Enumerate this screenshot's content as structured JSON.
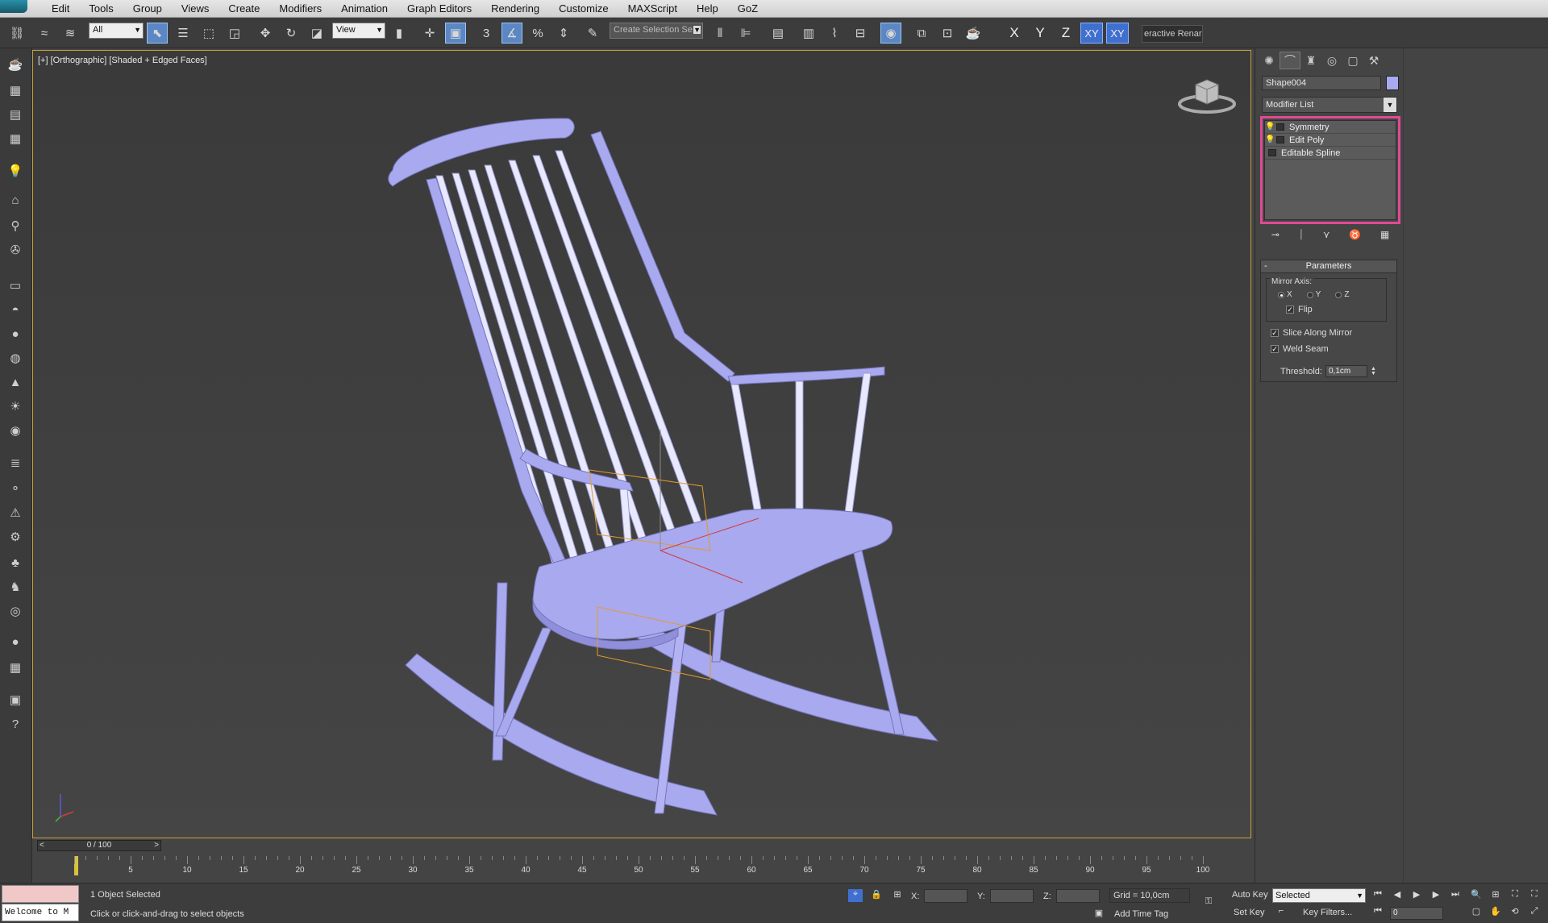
{
  "menubar": {
    "items": [
      "Edit",
      "Tools",
      "Group",
      "Views",
      "Create",
      "Modifiers",
      "Animation",
      "Graph Editors",
      "Rendering",
      "Customize",
      "MAXScript",
      "Help",
      "GoZ"
    ]
  },
  "toolbar": {
    "selection_filter": "All",
    "reference_coord": "View",
    "named_selection_placeholder": "Create Selection Se",
    "snap_label": "3",
    "percent_snap_label": "%",
    "axis_x": "X",
    "axis_y": "Y",
    "axis_z": "Z",
    "axis_xy": "XY",
    "axis_xy2": "XY",
    "render_label": "eractive Renar"
  },
  "viewport": {
    "label": "[+] [Orthographic] [Shaded + Edged Faces]",
    "mesh_color": "#a9a9f0",
    "selection_color": "#e39b2a"
  },
  "command_panel": {
    "object_name": "Shape004",
    "object_color": "#a9a9f0",
    "modifier_list": "Modifier List",
    "stack": [
      "Symmetry",
      "Edit Poly",
      "Editable Spline"
    ],
    "stack_highlight_color": "#e04a95",
    "parameters": {
      "title": "Parameters",
      "collapse": "-",
      "mirror_axis_label": "Mirror Axis:",
      "axis_options": [
        "X",
        "Y",
        "Z"
      ],
      "selected_axis": "X",
      "flip_label": "Flip",
      "flip_checked": true,
      "slice_label": "Slice Along Mirror",
      "slice_checked": true,
      "weld_label": "Weld Seam",
      "weld_checked": true,
      "threshold_label": "Threshold:",
      "threshold_value": "0,1cm"
    }
  },
  "timeline": {
    "slider_text": "0 / 100",
    "prev": "<",
    "next": ">",
    "ticks": [
      "5",
      "10",
      "15",
      "20",
      "25",
      "30",
      "35",
      "40",
      "45",
      "50",
      "55",
      "60",
      "65",
      "70",
      "75",
      "80",
      "85",
      "90",
      "95",
      "100"
    ]
  },
  "status": {
    "maxscript_text": "Welcome to M",
    "selection_info": "1 Object Selected",
    "prompt": "Click or click-and-drag to select objects",
    "x_label": "X:",
    "y_label": "Y:",
    "z_label": "Z:",
    "grid": "Grid = 10,0cm",
    "add_time_tag": "Add Time Tag",
    "auto_key": "Auto Key",
    "set_key": "Set Key",
    "selected_dropdown": "Selected",
    "key_filters": "Key Filters...",
    "current_frame": "0"
  }
}
